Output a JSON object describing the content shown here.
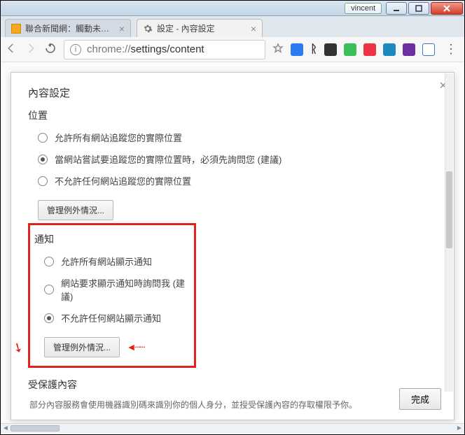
{
  "window": {
    "user": "vincent"
  },
  "tabs": [
    {
      "title": "聯合新聞網：觸動未來 新"
    },
    {
      "title": "設定 - 內容設定"
    }
  ],
  "omnibox": {
    "prefix": "chrome://",
    "path": "settings/content"
  },
  "dialog": {
    "title": "內容設定",
    "location": {
      "heading": "位置",
      "opt_allow": "允許所有網站追蹤您的實際位置",
      "opt_ask": "當網站嘗試要追蹤您的實際位置時，必須先詢問您 (建議)",
      "opt_block": "不允許任何網站追蹤您的實際位置",
      "manage": "管理例外情況..."
    },
    "notifications": {
      "heading": "通知",
      "opt_allow": "允許所有網站顯示通知",
      "opt_ask": "網站要求顯示通知時詢問我 (建議)",
      "opt_block": "不允許任何網站顯示通知",
      "manage": "管理例外情況..."
    },
    "protected": {
      "heading": "受保護內容",
      "desc": "部分內容服務會使用機器識別碼來識別你的個人身分，並授受保護內容的存取權限予你。"
    },
    "done": "完成"
  }
}
